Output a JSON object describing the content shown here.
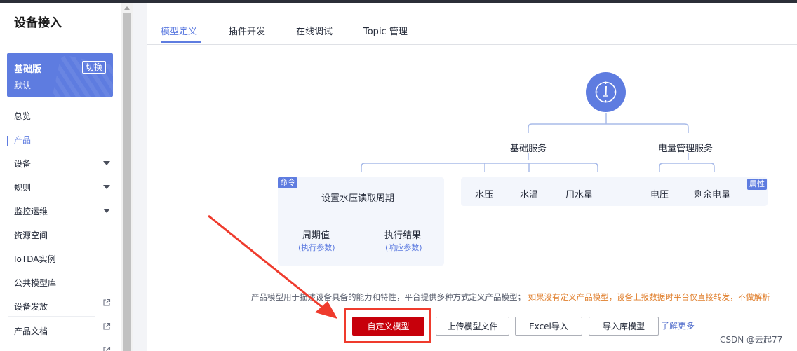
{
  "sidebar": {
    "title": "设备接入",
    "edition": {
      "name": "基础版",
      "switch_label": "切换",
      "subtitle": "默认"
    },
    "items": [
      {
        "label": "总览"
      },
      {
        "label": "产品"
      },
      {
        "label": "设备"
      },
      {
        "label": "规则"
      },
      {
        "label": "监控运维"
      },
      {
        "label": "资源空间"
      },
      {
        "label": "IoTDA实例"
      },
      {
        "label": "公共模型库"
      },
      {
        "label": "设备发放"
      },
      {
        "label": "产品文档"
      }
    ],
    "active_item": "产品"
  },
  "tabs": [
    {
      "label": "模型定义"
    },
    {
      "label": "插件开发"
    },
    {
      "label": "在线调试"
    },
    {
      "label": "Topic 管理"
    }
  ],
  "diagram": {
    "root_icon": "compass-icon",
    "services": [
      "基础服务",
      "电量管理服务"
    ],
    "command_tag": "命令",
    "command_name": "设置水压读取周期",
    "command_params": [
      {
        "name": "周期值",
        "type": "(执行参数)"
      },
      {
        "name": "执行结果",
        "type": "(响应参数)"
      }
    ],
    "basic_properties": [
      "水压",
      "水温",
      "用水量"
    ],
    "power_properties": [
      "电压",
      "剩余电量"
    ],
    "property_tag": "属性"
  },
  "description": {
    "text": "产品模型用于描述设备具备的能力和特性，平台提供多种方式定义产品模型；",
    "warning": "如果没有定义产品模型，设备上报数据时平台仅直接转发，不做解析"
  },
  "actions": {
    "custom_model": "自定义模型",
    "upload_model_file": "上传模型文件",
    "excel_import": "Excel导入",
    "import_library_model": "导入库模型",
    "learn_more": "了解更多"
  },
  "watermark": "CSDN @云起77",
  "colors": {
    "accent": "#5e7ce0",
    "primary_button": "#c7000b",
    "annotation_red": "#ef3b2d",
    "warning_text": "#e07f2d"
  }
}
